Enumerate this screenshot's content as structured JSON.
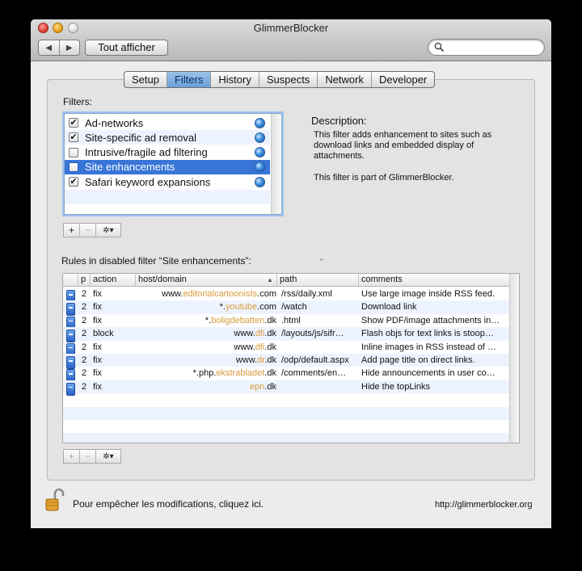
{
  "window": {
    "title": "GlimmerBlocker"
  },
  "toolbar": {
    "back_label": "◀",
    "forward_label": "▶",
    "show_all_label": "Tout afficher",
    "search_placeholder": "",
    "search_value": ""
  },
  "tabs": [
    {
      "label": "Setup",
      "selected": false
    },
    {
      "label": "Filters",
      "selected": true
    },
    {
      "label": "History",
      "selected": false
    },
    {
      "label": "Suspects",
      "selected": false
    },
    {
      "label": "Network",
      "selected": false
    },
    {
      "label": "Developer",
      "selected": false
    }
  ],
  "filters": {
    "label": "Filters:",
    "items": [
      {
        "name": "Ad-networks",
        "checked": true,
        "check": "✔"
      },
      {
        "name": "Site-specific ad removal",
        "checked": true,
        "check": "✔"
      },
      {
        "name": "Intrusive/fragile ad filtering",
        "checked": false,
        "check": ""
      },
      {
        "name": "Site enhancements",
        "checked": false,
        "selected": true,
        "check": ""
      },
      {
        "name": "Safari keyword expansions",
        "checked": true,
        "check": "✔"
      }
    ],
    "buttons": {
      "add": "+",
      "remove": "−",
      "action": "✲▾"
    }
  },
  "description": {
    "title": "Description:",
    "text": "This filter adds enhancement to sites such as download links and embedded display of attachments.",
    "part_of": "This filter is part of GlimmerBlocker."
  },
  "rules": {
    "label": "Rules in disabled filter “Site enhancements”:",
    "columns": {
      "p": "p",
      "action": "action",
      "host": "host/domain",
      "sort_arrow": "▲",
      "path": "path",
      "comments": "comments"
    },
    "rows": [
      {
        "p": "2",
        "action": "fix",
        "host_pre": "www.",
        "host_hl": "editorialcartoonists",
        "host_post": ".com",
        "path": "/rss/daily.xml",
        "comments": "Use large image inside RSS feed."
      },
      {
        "p": "2",
        "action": "fix",
        "host_pre": "*.",
        "host_hl": "youtube",
        "host_post": ".com",
        "path": "/watch",
        "comments": "Download link"
      },
      {
        "p": "2",
        "action": "fix",
        "host_pre": "*.",
        "host_hl": "boligdebatten",
        "host_post": ".dk",
        "path": ".html",
        "comments": "Show PDF/image attachments in…"
      },
      {
        "p": "2",
        "action": "block",
        "host_pre": "www.",
        "host_hl": "dfi",
        "host_post": ".dk",
        "path": "/layouts/js/sifr…",
        "comments": "Flash objs for text links is stoop…"
      },
      {
        "p": "2",
        "action": "fix",
        "host_pre": "www.",
        "host_hl": "dfi",
        "host_post": ".dk",
        "path": "",
        "comments": "Inline images in RSS instead of …"
      },
      {
        "p": "2",
        "action": "fix",
        "host_pre": "www.",
        "host_hl": "dr",
        "host_post": ".dk",
        "path": "/odp/default.aspx",
        "comments": "Add page title on direct links."
      },
      {
        "p": "2",
        "action": "fix",
        "host_pre": "*.php.",
        "host_hl": "ekstrabladet",
        "host_post": ".dk",
        "path": "/comments/en…",
        "comments": "Hide announcements in user co…"
      },
      {
        "p": "2",
        "action": "fix",
        "host_pre": "",
        "host_hl": "epn",
        "host_post": ".dk",
        "path": "",
        "comments": "Hide the topLinks"
      }
    ],
    "buttons": {
      "add": "+",
      "remove": "−",
      "action": "✲▾"
    }
  },
  "footer": {
    "lock_message": "Pour empêcher les modifications, cliquez ici.",
    "url": "http://glimmerblocker.org"
  },
  "colors": {
    "selection": "#3875d7",
    "host_highlight": "#d9993a",
    "tab_selected": "#7aaee0"
  }
}
